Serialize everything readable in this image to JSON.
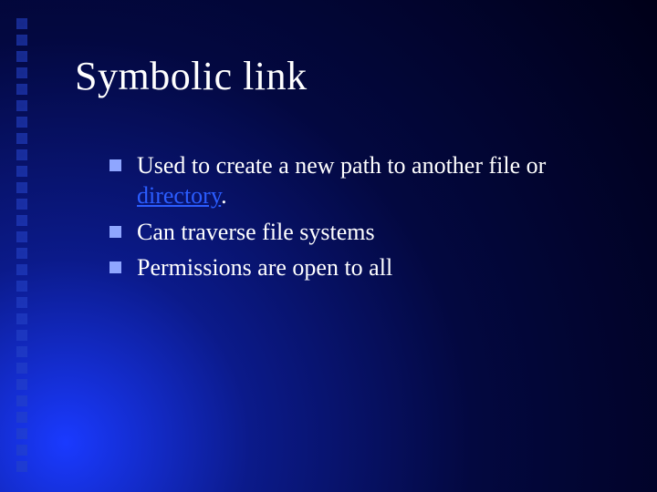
{
  "slide": {
    "title": "Symbolic link",
    "bullets": [
      {
        "prefix": "Used to create a new path to another file or ",
        "link": "directory",
        "suffix": "."
      },
      {
        "prefix": "Can traverse file systems",
        "link": "",
        "suffix": ""
      },
      {
        "prefix": "Permissions are open to all",
        "link": "",
        "suffix": ""
      }
    ]
  }
}
